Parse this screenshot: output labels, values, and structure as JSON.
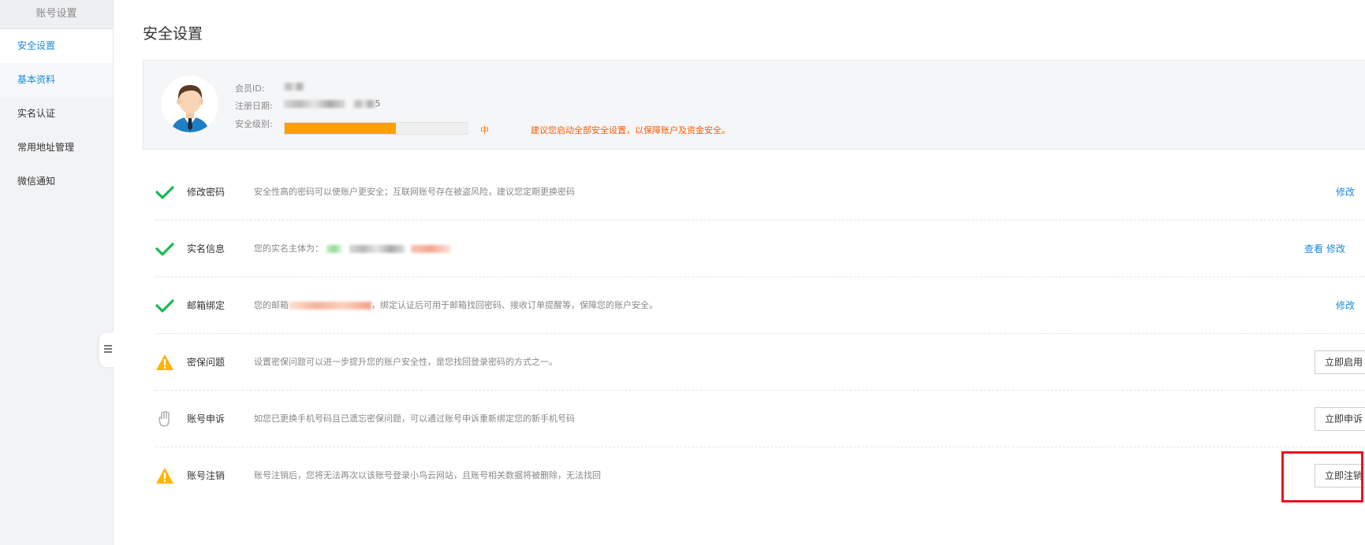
{
  "sidebar": {
    "header": "账号设置",
    "items": [
      {
        "label": "安全设置"
      },
      {
        "label": "基本资料"
      },
      {
        "label": "实名认证"
      },
      {
        "label": "常用地址管理"
      },
      {
        "label": "微信通知"
      }
    ]
  },
  "page_title": "安全设置",
  "profile": {
    "member_id_label": "会员ID:",
    "register_date_label": "注册日期:",
    "register_date_tail": "5",
    "security_level_label": "安全级别:",
    "security_level_progress_fraction": 0.61,
    "security_level_value": "中",
    "security_tip": "建议您启动全部安全设置，以保障账户及资金安全。",
    "level_color": "#ff9f00"
  },
  "security_items": [
    {
      "name": "修改密码",
      "status_icon": "check-icon",
      "description": "安全性高的密码可以使账户更安全；互联网账号存在被盗风险，建议您定期更换密码",
      "actions": [
        "修改"
      ]
    },
    {
      "name": "实名信息",
      "status_icon": "check-icon",
      "description": "您的实名主体为：",
      "actions": [
        "查看",
        "修改"
      ]
    },
    {
      "name": "邮箱绑定",
      "status_icon": "check-icon",
      "description_prefix": "您的邮箱",
      "description_suffix": "，绑定认证后可用于邮箱找回密码、接收订单提醒等，保障您的账户安全。",
      "actions": [
        "修改"
      ]
    },
    {
      "name": "密保问题",
      "status_icon": "warning-icon",
      "description": "设置密保问题可以进一步提升您的账户安全性，是您找回登录密码的方式之一。",
      "button": "立即启用"
    },
    {
      "name": "账号申诉",
      "status_icon": "hand-icon",
      "description": "如您已更换手机号码且已遗忘密保问题，可以通过账号申诉重新绑定您的新手机号码",
      "button": "立即申诉"
    },
    {
      "name": "账号注销",
      "status_icon": "warning-icon",
      "description": "账号注销后，您将无法再次以该账号登录小鸟云网站，且账号相关数据将被删除，无法找回",
      "button": "立即注销"
    }
  ],
  "colors": {
    "accent": "#1a8bd9",
    "check": "#19b956",
    "warning": "#ffb400",
    "highlight": "#e8141e"
  }
}
